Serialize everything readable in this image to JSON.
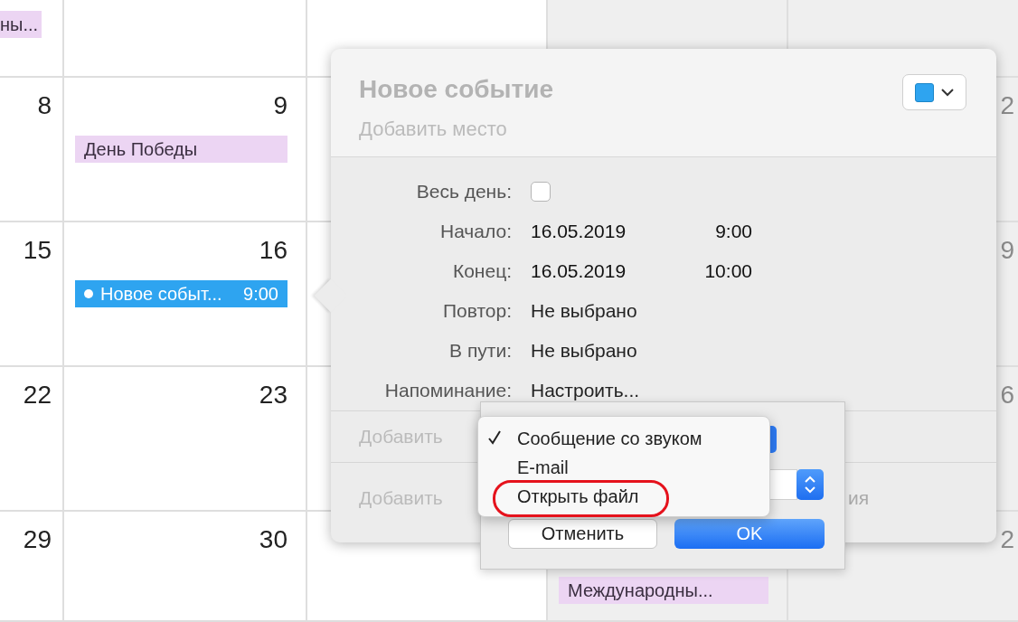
{
  "calendar": {
    "columns": [
      {
        "weekend": false
      },
      {
        "weekend": false
      },
      {
        "weekend": false
      },
      {
        "weekend": true
      },
      {
        "weekend": true
      }
    ],
    "rows": [
      {
        "cells": [
          {
            "events": [
              {
                "title": "ны...",
                "color": "#ecd5f3"
              }
            ]
          },
          {},
          {},
          {},
          {}
        ]
      },
      {
        "cells": [
          {
            "day": "8"
          },
          {
            "day": "9",
            "events": [
              {
                "title": "День Победы",
                "color": "#ecd5f3"
              }
            ]
          },
          {},
          {},
          {
            "day": "2"
          }
        ]
      },
      {
        "cells": [
          {
            "day": "15"
          },
          {
            "day": "16",
            "events": [
              {
                "title": "Новое событ...",
                "time": "9:00",
                "color": "#2ea4f0"
              }
            ]
          },
          {},
          {},
          {
            "day": "9"
          }
        ]
      },
      {
        "cells": [
          {
            "day": "22"
          },
          {
            "day": "23"
          },
          {},
          {},
          {
            "day": "6"
          }
        ]
      },
      {
        "cells": [
          {
            "day": "29"
          },
          {
            "day": "30"
          },
          {},
          {
            "events": [
              {
                "title": "Международны...",
                "color": "#ecd5f3"
              }
            ]
          },
          {
            "day": "2"
          }
        ]
      }
    ]
  },
  "popover": {
    "title": "Новое событие",
    "location_placeholder": "Добавить место",
    "fields": [
      {
        "kind": "checkbox",
        "label": "Весь день:",
        "checked": false
      },
      {
        "kind": "datetime",
        "label": "Начало:",
        "date": "16.05.2019",
        "time": "9:00"
      },
      {
        "kind": "datetime",
        "label": "Конец:",
        "date": "16.05.2019",
        "time": "10:00"
      },
      {
        "kind": "text",
        "label": "Повтор:",
        "value": "Не выбрано"
      },
      {
        "kind": "text",
        "label": "В пути:",
        "value": "Не выбрано"
      },
      {
        "kind": "text",
        "label": "Напоминание:",
        "value": "Настроить..."
      }
    ],
    "add_rows": [
      {
        "text": "Добавить"
      },
      {
        "text": "Добавить",
        "tail": "ия"
      }
    ]
  },
  "sheet": {
    "cancel": "Отменить",
    "ok": "OK",
    "menu": [
      {
        "label": "Сообщение со звуком",
        "selected": true,
        "circled": false
      },
      {
        "label": "E-mail",
        "selected": false,
        "circled": false
      },
      {
        "label": "Открыть файл",
        "selected": false,
        "circled": true
      }
    ]
  }
}
